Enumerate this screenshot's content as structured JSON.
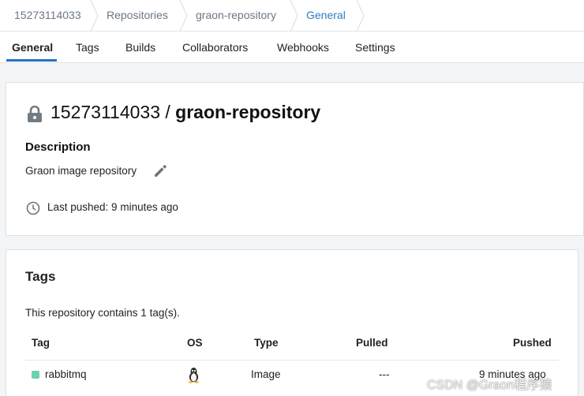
{
  "breadcrumb": {
    "items": [
      "15273114033",
      "Repositories",
      "graon-repository",
      "General"
    ]
  },
  "tabs": [
    "General",
    "Tags",
    "Builds",
    "Collaborators",
    "Webhooks",
    "Settings"
  ],
  "repo": {
    "owner": "15273114033",
    "separator": "/",
    "name": "graon-repository",
    "description_heading": "Description",
    "description": "Graon image repository",
    "last_pushed": "Last pushed: 9 minutes ago"
  },
  "tags_section": {
    "heading": "Tags",
    "count_text": "This repository contains 1 tag(s).",
    "columns": [
      "Tag",
      "OS",
      "Type",
      "Pulled",
      "Pushed"
    ],
    "rows": [
      {
        "tag": "rabbitmq",
        "os_icon": "linux-icon",
        "type": "Image",
        "pulled": "---",
        "pushed": "9 minutes ago"
      }
    ]
  },
  "watermark": "CSDN @Graon程序猿",
  "colors": {
    "accent": "#2372c8",
    "breadcrumb_active": "#2f7dc4",
    "tag_dot": "#6fd0b0"
  }
}
